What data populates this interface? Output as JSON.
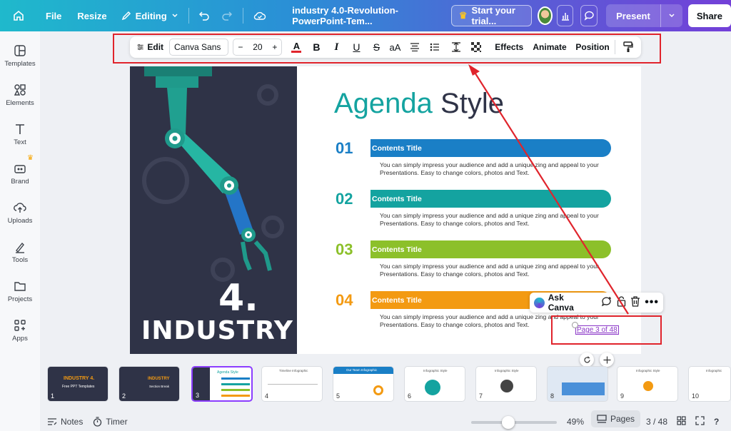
{
  "topbar": {
    "file": "File",
    "resize": "Resize",
    "editing": "Editing",
    "doc_title": "industry 4.0-Revolution-PowerPoint-Tem...",
    "trial": "Start your trial...",
    "present": "Present",
    "share": "Share"
  },
  "sidebar": {
    "items": [
      {
        "label": "Templates",
        "icon": "templates-icon"
      },
      {
        "label": "Elements",
        "icon": "elements-icon"
      },
      {
        "label": "Text",
        "icon": "text-icon"
      },
      {
        "label": "Brand",
        "icon": "brand-icon"
      },
      {
        "label": "Uploads",
        "icon": "uploads-icon"
      },
      {
        "label": "Tools",
        "icon": "tools-icon"
      },
      {
        "label": "Projects",
        "icon": "projects-icon"
      },
      {
        "label": "Apps",
        "icon": "apps-icon"
      }
    ]
  },
  "toolbar": {
    "edit": "Edit",
    "font": "Canva Sans",
    "size": "20",
    "case": "aA",
    "effects": "Effects",
    "animate": "Animate",
    "position": "Position",
    "text_color": "#e0242c"
  },
  "slide": {
    "title_a": "Agenda",
    "title_b": "Style",
    "big_num": "4.",
    "big_word": "INDUSTRY",
    "items": [
      {
        "num": "01",
        "title": "Contents Title",
        "color": "#1a7fc6",
        "desc1": "You can simply impress your audience and add a unique zing and appeal to your",
        "desc2": "Presentations. Easy to change colors, photos and Text."
      },
      {
        "num": "02",
        "title": "Contents Title",
        "color": "#14a3a0",
        "desc1": "You can simply impress your audience and add a unique zing and appeal to your",
        "desc2": "Presentations. Easy to change colors, photos and Text."
      },
      {
        "num": "03",
        "title": "Contents Title",
        "color": "#8cc02a",
        "desc1": "You can simply impress your audience and add a unique zing and appeal to your",
        "desc2": "Presentations. Easy to change colors, photos and Text."
      },
      {
        "num": "04",
        "title": "Contents Title",
        "color": "#f39a12",
        "desc1": "You can simply impress your audience and add a unique zing and appeal to your",
        "desc2": "Presentations. Easy to change colors, photos and Text."
      }
    ],
    "page_link": "Page 3 of 48"
  },
  "context_menu": {
    "ask": "Ask Canva"
  },
  "thumbnails": [
    {
      "n": "1",
      "title": "INDUSTRY 4.",
      "sub": "Free PPT Templates"
    },
    {
      "n": "2",
      "title": "INDUSTRY",
      "sub": "Section Break"
    },
    {
      "n": "3",
      "title": "Agenda Style"
    },
    {
      "n": "4",
      "title": "Timeline Infographic"
    },
    {
      "n": "5",
      "title": "Our Team Infographic"
    },
    {
      "n": "6",
      "title": "Infographic Style"
    },
    {
      "n": "7",
      "title": "Infographic Style"
    },
    {
      "n": "8",
      "title": ""
    },
    {
      "n": "9",
      "title": "Infographic Style"
    },
    {
      "n": "10",
      "title": "Infographic"
    }
  ],
  "bottom": {
    "notes": "Notes",
    "timer": "Timer",
    "zoom": "49%",
    "pages": "Pages",
    "page_count": "3 / 48"
  }
}
